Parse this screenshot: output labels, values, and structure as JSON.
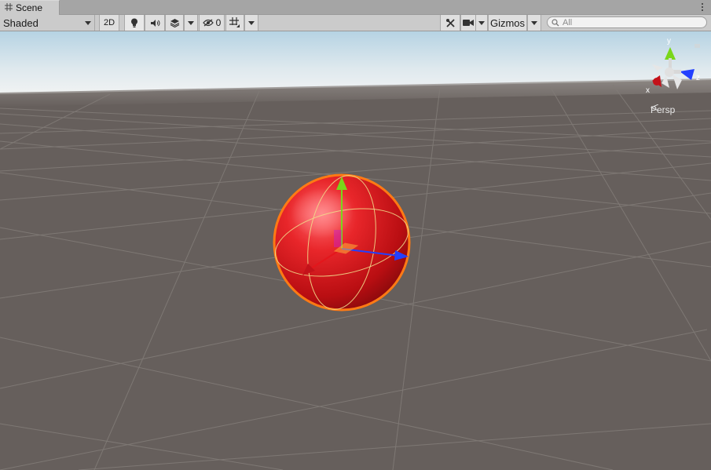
{
  "window": {
    "tab_label": "Scene",
    "tab_icon": "grid-icon",
    "menu_icon": "kebab-menu-icon"
  },
  "toolbar": {
    "draw_mode": "Shaded",
    "mode_2d": "2D",
    "lighting_icon": "light-bulb-icon",
    "audio_icon": "speaker-icon",
    "effects_icon": "layers-icon",
    "hidden_icon": "eye-slash-icon",
    "hidden_count": "0",
    "grid_icon": "grid-snap-icon",
    "tools_icon": "tools-icon",
    "camera_icon": "camera-icon",
    "gizmos_label": "Gizmos",
    "search_placeholder": "All"
  },
  "scene": {
    "gizmo_axes": {
      "y": "y",
      "z": "z",
      "x": "x"
    },
    "projection_label": "Persp",
    "colors": {
      "sky_top": "#b4d2e2",
      "horizon": "#eef2f3",
      "ground": "#665f5c",
      "grid_line": "#807a76",
      "sphere": "#d4181c",
      "selection_outline": "#ff7a14",
      "axis_x": "#e4161c",
      "axis_y": "#7ad61a",
      "axis_z": "#2240ff"
    }
  }
}
